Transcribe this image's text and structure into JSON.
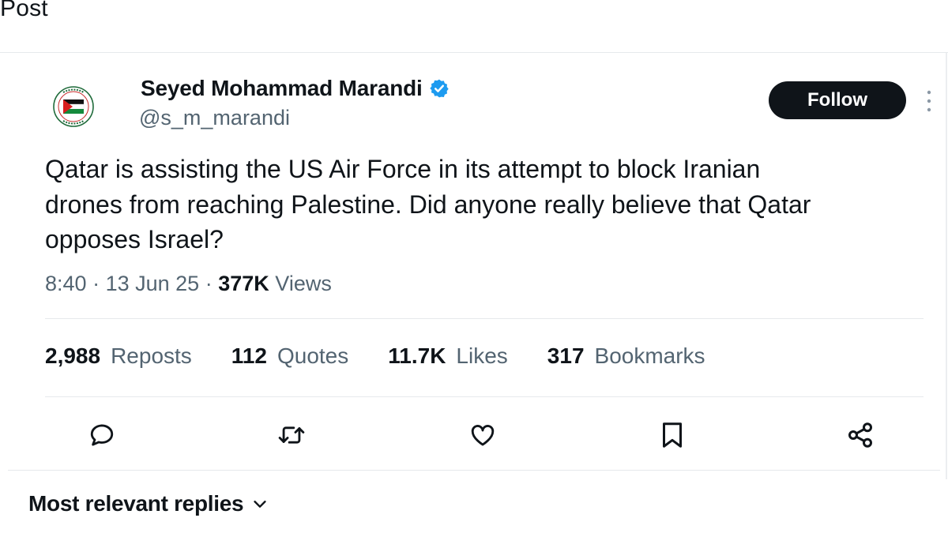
{
  "header": {
    "title": "Post"
  },
  "author": {
    "name": "Seyed Mohammad Marandi",
    "handle": "@s_m_marandi",
    "verified_color": "#1d9bf0",
    "avatar_icon": "palestine-flag-emblem"
  },
  "follow_button": {
    "label": "Follow"
  },
  "tweet": {
    "text": "Qatar is assisting the US Air Force in its attempt to block Iranian\ndrones from reaching Palestine. Did anyone really believe that Qatar\nopposes Israel?",
    "time": "8:40",
    "date": "13 Jun 25",
    "views_count": "377K",
    "views_label": "Views"
  },
  "stats": [
    {
      "count": "2,988",
      "label": "Reposts"
    },
    {
      "count": "112",
      "label": "Quotes"
    },
    {
      "count": "11.7K",
      "label": "Likes"
    },
    {
      "count": "317",
      "label": "Bookmarks"
    }
  ],
  "actions": [
    "reply-icon",
    "repost-icon",
    "like-icon",
    "bookmark-icon",
    "share-icon"
  ],
  "replies": {
    "sort_label": "Most relevant replies"
  },
  "colors": {
    "text": "#0f1419",
    "secondary": "#536471",
    "divider": "#e6e9ec",
    "accent": "#1d9bf0"
  }
}
